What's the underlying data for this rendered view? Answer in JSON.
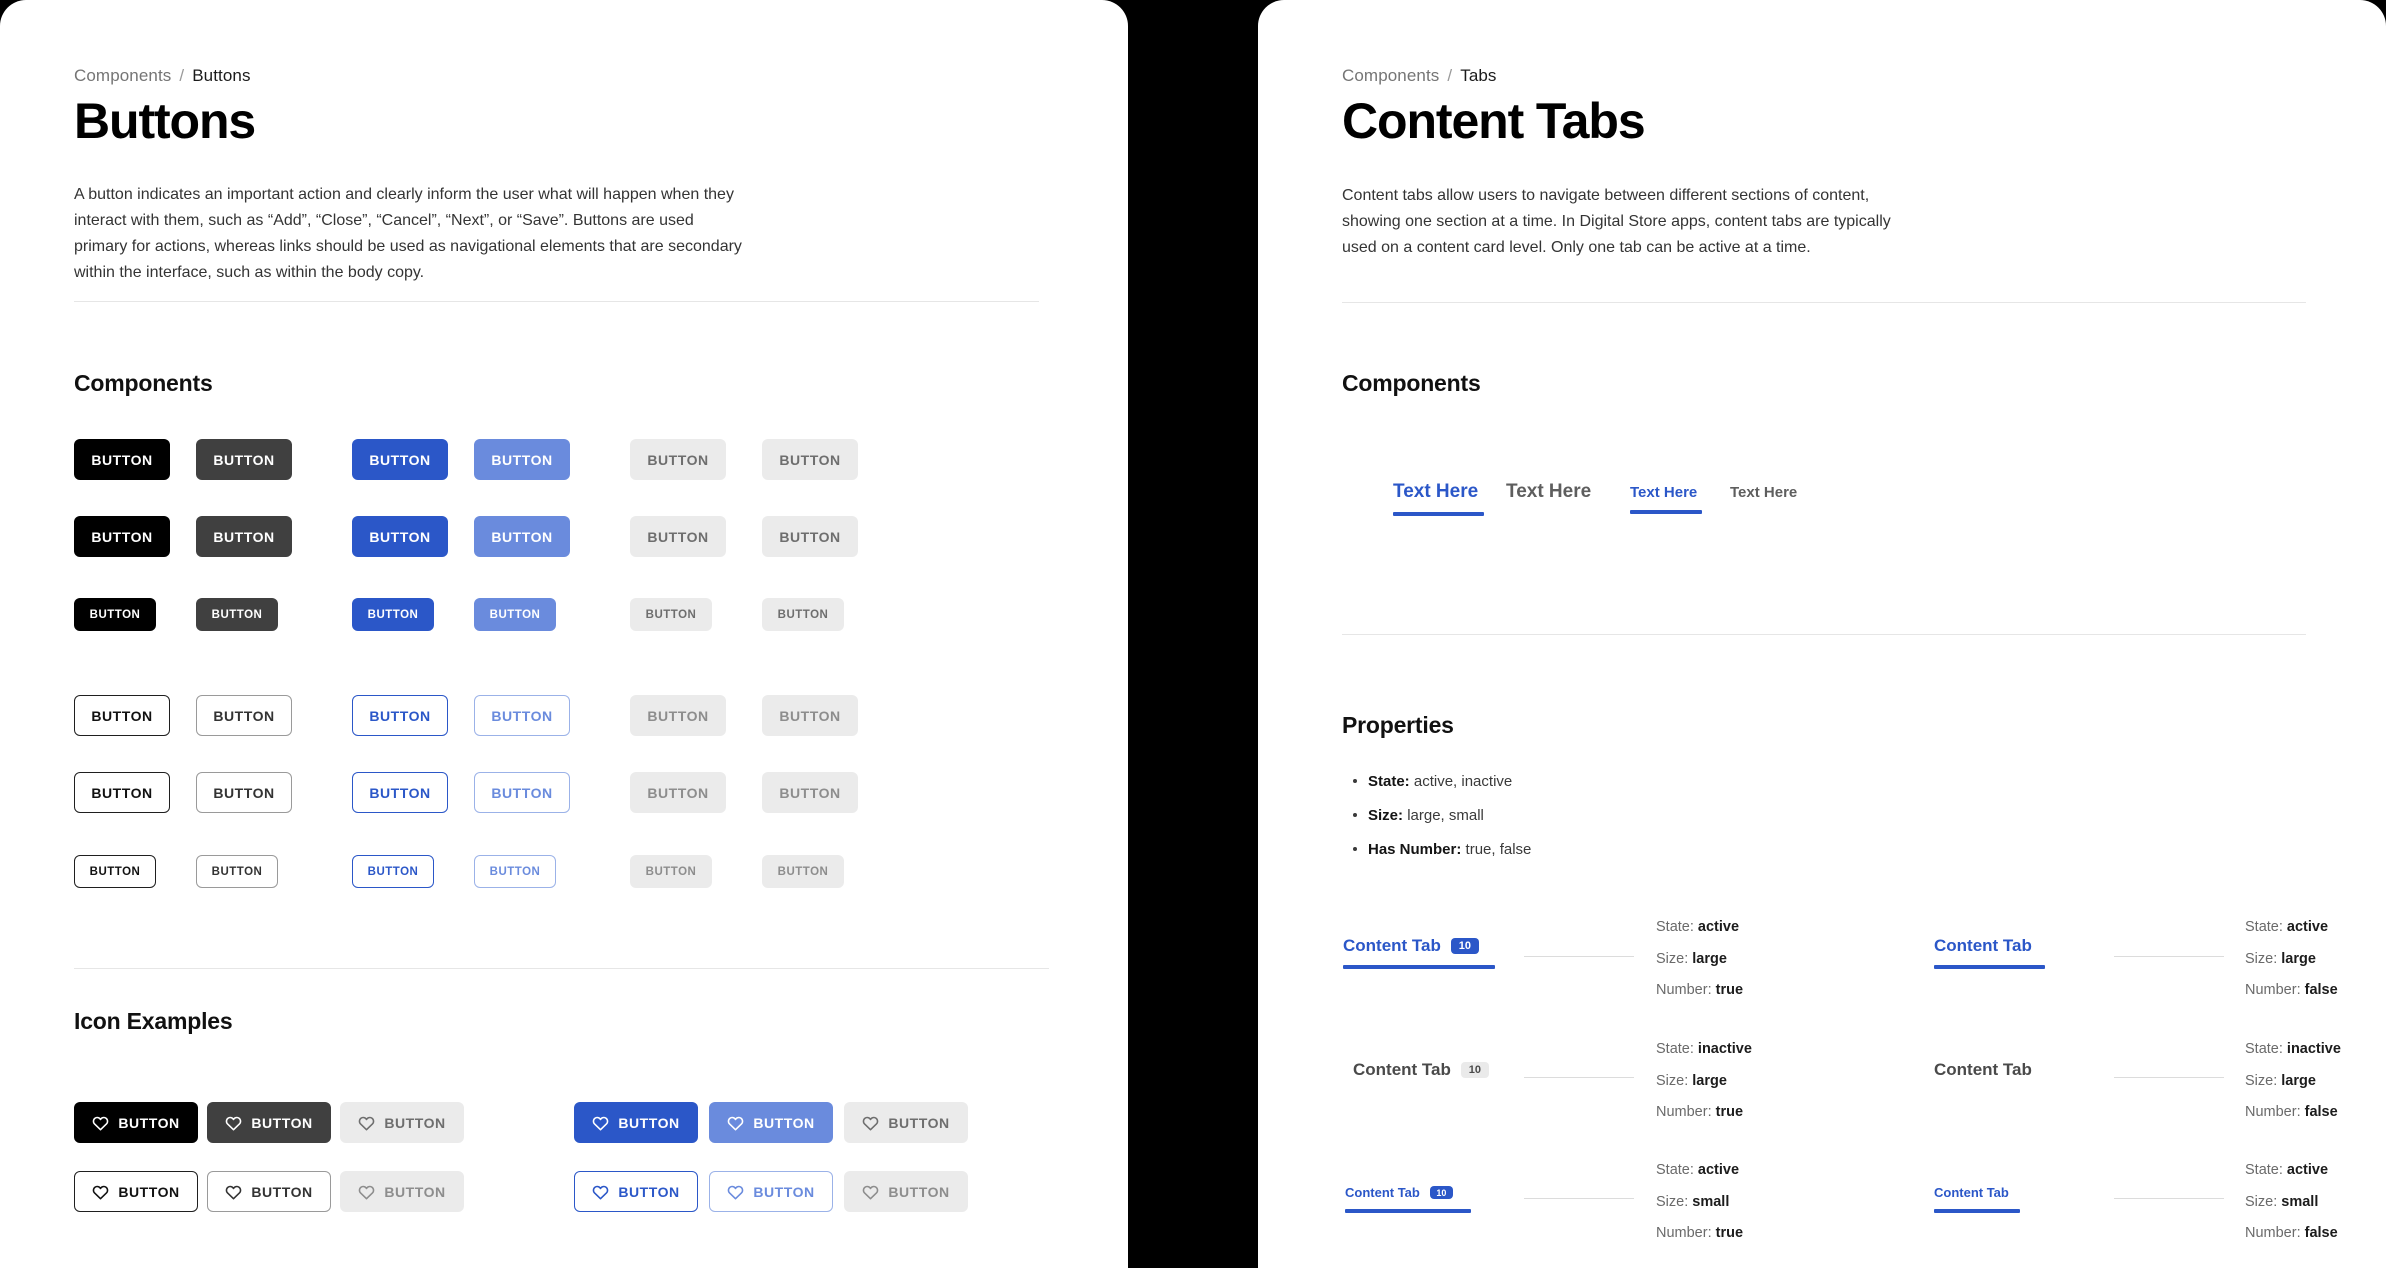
{
  "theme": {
    "accent_blue": "#2B57C8",
    "accent_blue_light": "#6A8BDD",
    "black": "#000000",
    "dark_gray": "#404040",
    "disabled_bg": "#ebebeb",
    "page_gap": "#000000"
  },
  "left_panel": {
    "breadcrumb": {
      "root": "Components",
      "separator": "/",
      "current": "Buttons"
    },
    "title": "Buttons",
    "intro": "A button indicates an important action and clearly inform the user what will happen when they interact with them, such as “Add”, “Close”, “Cancel”, “Next”, or “Save”. Buttons are used primary for actions, whereas links should be used as navigational elements that are secondary within the interface, such as within the body copy.",
    "components_heading": "Components",
    "icon_examples_heading": "Icon Examples",
    "button_label": "BUTTON",
    "solid_rows": [
      {
        "size": "large",
        "buttons": [
          {
            "label": "BUTTON",
            "variant": "black"
          },
          {
            "label": "BUTTON",
            "variant": "dark"
          },
          {
            "label": "BUTTON",
            "variant": "blue"
          },
          {
            "label": "BUTTON",
            "variant": "blue-light"
          },
          {
            "label": "BUTTON",
            "variant": "disabled"
          },
          {
            "label": "BUTTON",
            "variant": "disabled"
          }
        ]
      },
      {
        "size": "medium",
        "buttons": [
          {
            "label": "BUTTON",
            "variant": "black"
          },
          {
            "label": "BUTTON",
            "variant": "dark"
          },
          {
            "label": "BUTTON",
            "variant": "blue"
          },
          {
            "label": "BUTTON",
            "variant": "blue-light"
          },
          {
            "label": "BUTTON",
            "variant": "disabled"
          },
          {
            "label": "BUTTON",
            "variant": "disabled"
          }
        ]
      },
      {
        "size": "small",
        "buttons": [
          {
            "label": "BUTTON",
            "variant": "black"
          },
          {
            "label": "BUTTON",
            "variant": "dark"
          },
          {
            "label": "BUTTON",
            "variant": "blue"
          },
          {
            "label": "BUTTON",
            "variant": "blue-light"
          },
          {
            "label": "BUTTON",
            "variant": "disabled"
          },
          {
            "label": "BUTTON",
            "variant": "disabled"
          }
        ]
      }
    ],
    "outline_rows": [
      {
        "size": "large",
        "buttons": [
          {
            "label": "BUTTON",
            "variant": "outline-black"
          },
          {
            "label": "BUTTON",
            "variant": "outline-dark"
          },
          {
            "label": "BUTTON",
            "variant": "outline-blue"
          },
          {
            "label": "BUTTON",
            "variant": "outline-blue-light"
          },
          {
            "label": "BUTTON",
            "variant": "outline-disabled"
          },
          {
            "label": "BUTTON",
            "variant": "outline-disabled"
          }
        ]
      },
      {
        "size": "medium",
        "buttons": [
          {
            "label": "BUTTON",
            "variant": "outline-black"
          },
          {
            "label": "BUTTON",
            "variant": "outline-dark"
          },
          {
            "label": "BUTTON",
            "variant": "outline-blue"
          },
          {
            "label": "BUTTON",
            "variant": "outline-blue-light"
          },
          {
            "label": "BUTTON",
            "variant": "outline-disabled"
          },
          {
            "label": "BUTTON",
            "variant": "outline-disabled"
          }
        ]
      },
      {
        "size": "small",
        "buttons": [
          {
            "label": "BUTTON",
            "variant": "outline-black"
          },
          {
            "label": "BUTTON",
            "variant": "outline-dark"
          },
          {
            "label": "BUTTON",
            "variant": "outline-blue"
          },
          {
            "label": "BUTTON",
            "variant": "outline-blue-light"
          },
          {
            "label": "BUTTON",
            "variant": "outline-disabled"
          },
          {
            "label": "BUTTON",
            "variant": "outline-disabled"
          }
        ]
      }
    ],
    "icon_rows": [
      {
        "buttons": [
          {
            "label": "BUTTON",
            "icon": "heart-icon",
            "variant": "black"
          },
          {
            "label": "BUTTON",
            "icon": "heart-icon",
            "variant": "dark"
          },
          {
            "label": "BUTTON",
            "icon": "heart-icon",
            "variant": "disabled"
          },
          {
            "label": "BUTTON",
            "icon": "heart-icon",
            "variant": "blue"
          },
          {
            "label": "BUTTON",
            "icon": "heart-icon",
            "variant": "blue-light"
          },
          {
            "label": "BUTTON",
            "icon": "heart-icon",
            "variant": "disabled"
          }
        ]
      },
      {
        "buttons": [
          {
            "label": "BUTTON",
            "icon": "heart-icon",
            "variant": "outline-black"
          },
          {
            "label": "BUTTON",
            "icon": "heart-icon",
            "variant": "outline-dark"
          },
          {
            "label": "BUTTON",
            "icon": "heart-icon",
            "variant": "outline-disabled"
          },
          {
            "label": "BUTTON",
            "icon": "heart-icon",
            "variant": "outline-blue"
          },
          {
            "label": "BUTTON",
            "icon": "heart-icon",
            "variant": "outline-blue-light"
          },
          {
            "label": "BUTTON",
            "icon": "heart-icon",
            "variant": "outline-disabled"
          }
        ]
      }
    ]
  },
  "right_panel": {
    "breadcrumb": {
      "root": "Components",
      "separator": "/",
      "current": "Tabs"
    },
    "title": "Content Tabs",
    "intro": "Content tabs allow users to navigate between different sections of content, showing one section at a time. In Digital Store apps, content tabs are typically used on a content card level. Only one tab can be active at a time.",
    "components_heading": "Components",
    "properties_heading": "Properties",
    "properties": [
      {
        "name": "State:",
        "values": "active, inactive"
      },
      {
        "name": "Size:",
        "values": "large, small"
      },
      {
        "name": "Has Number:",
        "values": "true, false"
      }
    ],
    "text_tabs": [
      {
        "label": "Text Here",
        "state": "active",
        "size": "large"
      },
      {
        "label": "Text Here",
        "state": "inactive",
        "size": "large"
      },
      {
        "label": "Text Here",
        "state": "active",
        "size": "small"
      },
      {
        "label": "Text Here",
        "state": "inactive",
        "size": "small"
      }
    ],
    "spec_labels": {
      "state": "State:",
      "size": "Size:",
      "number": "Number:"
    },
    "content_tabs": [
      {
        "label": "Content Tab",
        "badge": "10",
        "state": "active",
        "size": "large",
        "number": "true",
        "specs": {
          "state": "active",
          "size": "large",
          "number": "true"
        }
      },
      {
        "label": "Content Tab",
        "badge": "10",
        "state": "inactive",
        "size": "large",
        "number": "true",
        "specs": {
          "state": "inactive",
          "size": "large",
          "number": "true"
        }
      },
      {
        "label": "Content Tab",
        "badge": "10",
        "state": "active",
        "size": "small",
        "number": "true",
        "specs": {
          "state": "active",
          "size": "small",
          "number": "true"
        }
      },
      {
        "label": "Content Tab",
        "badge": null,
        "state": "active",
        "size": "large",
        "number": "false",
        "specs": {
          "state": "active",
          "size": "large",
          "number": "false"
        }
      },
      {
        "label": "Content Tab",
        "badge": null,
        "state": "inactive",
        "size": "large",
        "number": "false",
        "specs": {
          "state": "inactive",
          "size": "large",
          "number": "false"
        }
      },
      {
        "label": "Content Tab",
        "badge": null,
        "state": "active",
        "size": "small",
        "number": "false",
        "specs": {
          "state": "active",
          "size": "small",
          "number": "false"
        }
      }
    ]
  }
}
